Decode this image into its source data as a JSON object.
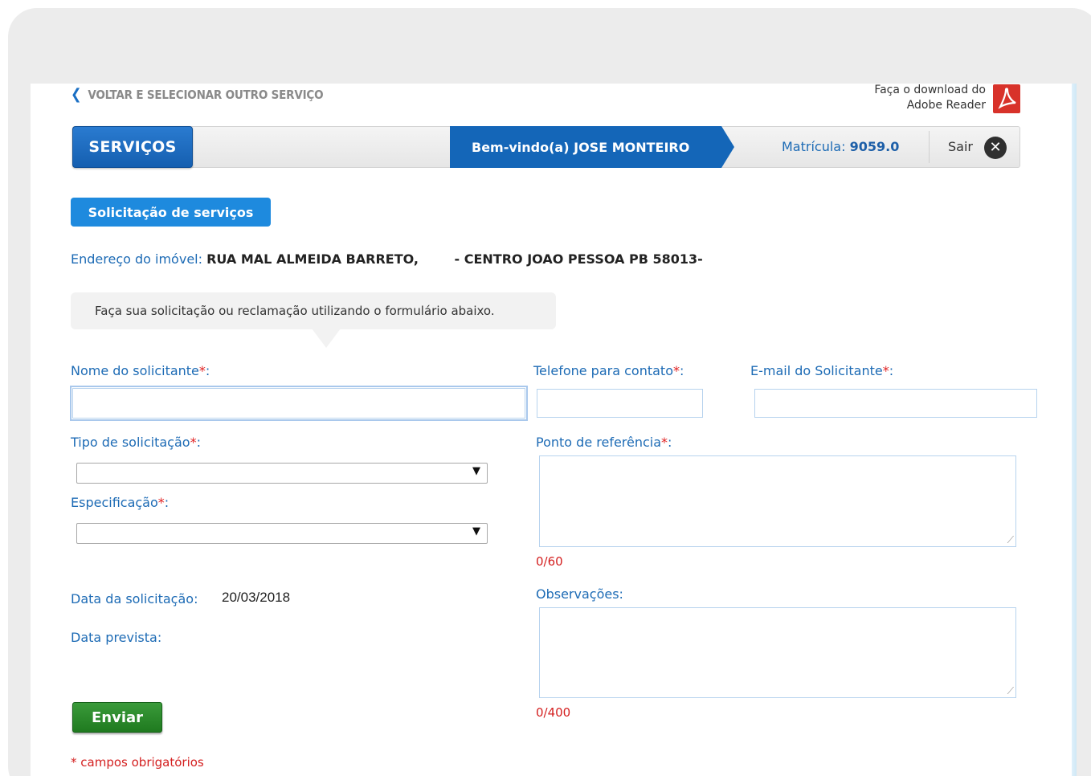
{
  "back_link": {
    "icon": "chevron-left-icon",
    "label": "VOLTAR E SELECIONAR OUTRO SERVIÇO"
  },
  "adobe": {
    "line1": "Faça o download do",
    "line2": "Adobe Reader",
    "icon": "pdf-icon"
  },
  "navbar": {
    "servicos_label": "SERVIÇOS",
    "welcome_prefix": "Bem-vindo(a)",
    "user_name": "JOSE MONTEIRO",
    "matricula_label": "Matrícula:",
    "matricula_value": "9059.0",
    "sair_label": "Sair",
    "sair_icon": "close-circle-icon"
  },
  "section_title": "Solicitação de serviços",
  "endereco": {
    "label": "Endereço do imóvel:",
    "value": "RUA MAL ALMEIDA BARRETO,        - CENTRO JOAO PESSOA PB 58013-"
  },
  "instruction": "Faça sua solicitação ou reclamação utilizando o formulário abaixo.",
  "form": {
    "nome_label": "Nome do solicitante",
    "nome_value": "",
    "telefone_label": "Telefone para contato",
    "telefone_value": "",
    "email_label": "E-mail do Solicitante",
    "email_value": "",
    "tipo_label": "Tipo de solicitação",
    "tipo_value": "",
    "especificacao_label": "Especificação",
    "especificacao_value": "",
    "ponto_label": "Ponto de referência",
    "ponto_counter": "0/60",
    "observacoes_label": "Observações:",
    "observacoes_counter": "0/400",
    "data_solicitacao_label": "Data da solicitação:",
    "data_solicitacao_value": "20/03/2018",
    "data_prevista_label": "Data prevista:",
    "required_mark": "*",
    "colon": ":",
    "submit_label": "Enviar",
    "required_note_mark": "*",
    "required_note_text": "campos obrigatórios"
  },
  "colors": {
    "primary": "#1466b8",
    "link": "#1d6bb5",
    "required": "#e02020",
    "submit": "#2a8a2a"
  }
}
